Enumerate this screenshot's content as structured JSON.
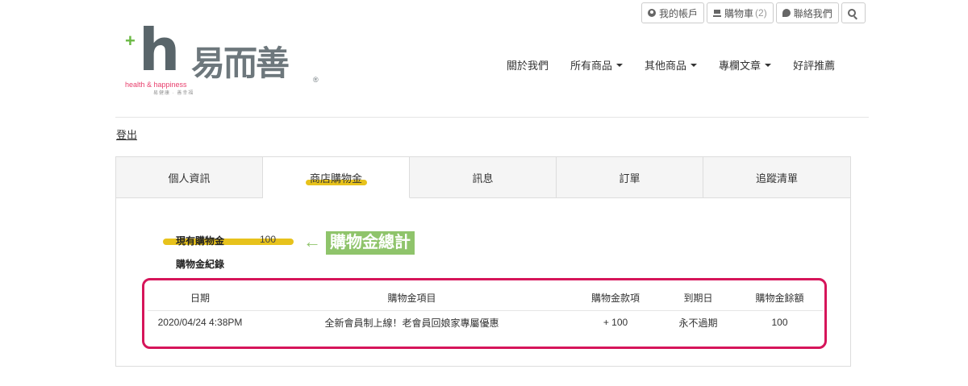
{
  "topbar": {
    "account": "我的帳戶",
    "cart": "購物車",
    "cart_count": "(2)",
    "contact": "聯絡我們"
  },
  "logo": {
    "mark": "h",
    "plus": "+",
    "name": "易而善",
    "registered": "®",
    "tagline": "health & happiness",
    "tagline_cn": "易健康 · 善幸福"
  },
  "nav": {
    "items": [
      {
        "label": "關於我們",
        "dropdown": false
      },
      {
        "label": "所有商品",
        "dropdown": true
      },
      {
        "label": "其他商品",
        "dropdown": true
      },
      {
        "label": "專欄文章",
        "dropdown": true
      },
      {
        "label": "好評推薦",
        "dropdown": false
      }
    ]
  },
  "logout": "登出",
  "tabs": [
    {
      "label": "個人資訊",
      "active": false
    },
    {
      "label": "商店購物金",
      "active": true
    },
    {
      "label": "訊息",
      "active": false
    },
    {
      "label": "訂單",
      "active": false
    },
    {
      "label": "追蹤清單",
      "active": false
    }
  ],
  "credit": {
    "current_label": "現有購物金",
    "current_value": "100",
    "history_label": "購物金紀錄",
    "callout": "購物金總計",
    "arrow": "←"
  },
  "table": {
    "headers": [
      "日期",
      "購物金項目",
      "購物金款項",
      "到期日",
      "購物金餘額"
    ],
    "rows": [
      [
        "2020/04/24 4:38PM",
        "全新會員制上線！老會員回娘家專屬優惠",
        "+ 100",
        "永不過期",
        "100"
      ]
    ]
  },
  "colors": {
    "highlight_yellow": "#e7c21c",
    "callout_green": "#8fc46b",
    "box_magenta": "#d6155a",
    "logo_green": "#6bb944",
    "logo_gray": "#59656a"
  }
}
